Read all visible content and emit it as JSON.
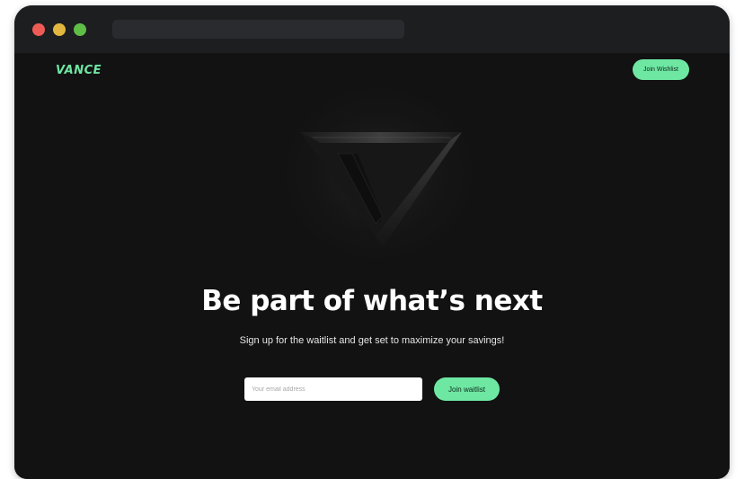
{
  "brand": {
    "logo_text": "VANCE",
    "accent_color": "#6ee7a3"
  },
  "nav": {
    "cta_label": "Join Wishlist"
  },
  "hero": {
    "emblem_icon": "vance-v-emblem-icon",
    "headline": "Be part of what’s next",
    "subheadline": "Sign up for the waitlist and get set to maximize your savings!"
  },
  "signup": {
    "email_placeholder": "Your email address",
    "email_value": "",
    "submit_label": "Join waitlist"
  }
}
